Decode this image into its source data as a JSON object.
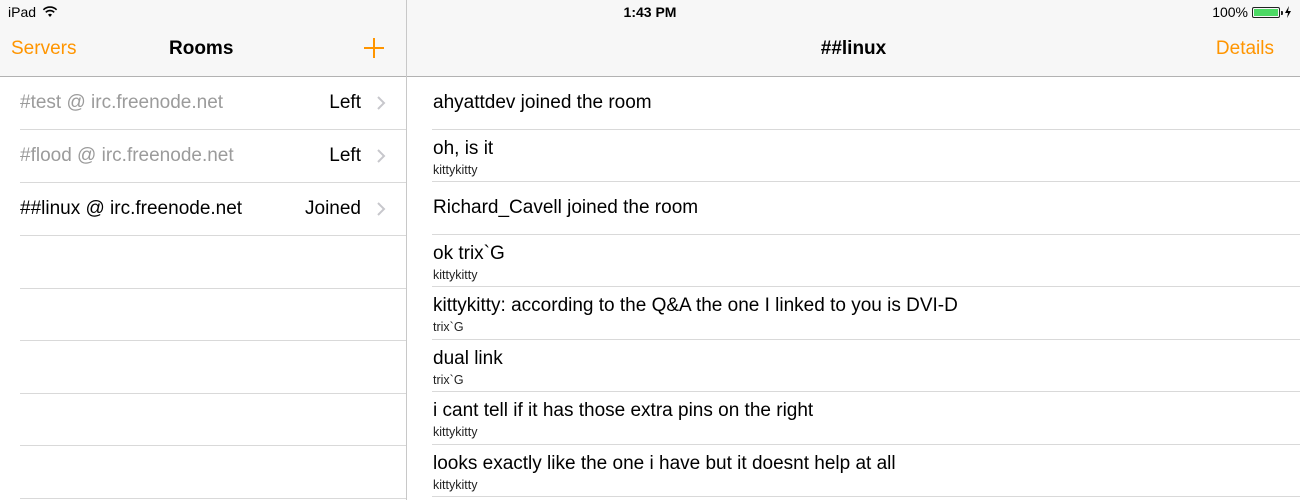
{
  "status": {
    "device": "iPad",
    "time": "1:43 PM",
    "battery": "100%",
    "battery_level": 1.0
  },
  "sidebar": {
    "back_label": "Servers",
    "title": "Rooms",
    "add_icon": "plus-icon",
    "rooms": [
      {
        "name": "#test @ irc.freenode.net",
        "state": "Left",
        "active": false
      },
      {
        "name": "#flood @ irc.freenode.net",
        "state": "Left",
        "active": false
      },
      {
        "name": "##linux @ irc.freenode.net",
        "state": "Joined",
        "active": true
      }
    ]
  },
  "chat": {
    "title": "##linux",
    "details_label": "Details",
    "messages": [
      {
        "text": "ahyattdev joined the room",
        "author": ""
      },
      {
        "text": "oh, is it",
        "author": "kittykitty"
      },
      {
        "text": "Richard_Cavell joined the room",
        "author": ""
      },
      {
        "text": "ok trix`G",
        "author": "kittykitty"
      },
      {
        "text": "kittykitty: according to the Q&A the one I linked to you is DVI-D",
        "author": "trix`G"
      },
      {
        "text": "dual link",
        "author": "trix`G"
      },
      {
        "text": "i cant tell if it has those extra pins on the right",
        "author": "kittykitty"
      },
      {
        "text": "looks exactly like the one i have but it doesnt help at all",
        "author": "kittykitty"
      }
    ]
  },
  "colors": {
    "accent": "#ff9500",
    "dimmed_text": "#9b9b9b",
    "battery_fill": "#4cd964"
  }
}
